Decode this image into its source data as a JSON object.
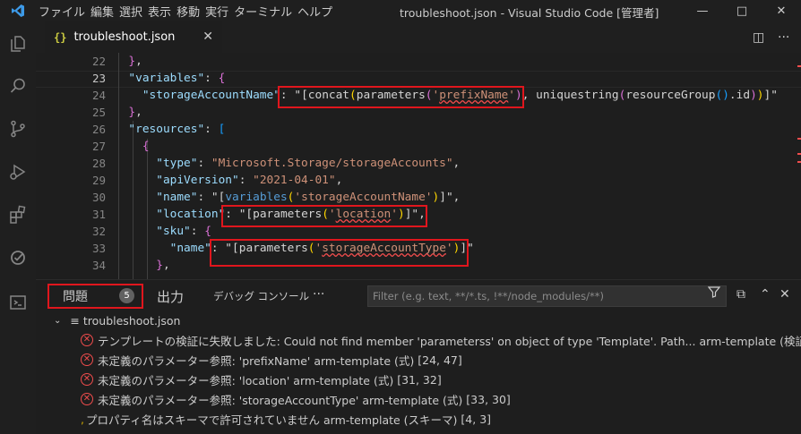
{
  "window": {
    "title": "troubleshoot.json - Visual Studio Code [管理者]",
    "menu": [
      "ファイル",
      "編集",
      "選択",
      "表示",
      "移動",
      "実行",
      "ターミナル",
      "ヘルプ"
    ]
  },
  "tabs": [
    {
      "label": "troubleshoot.json",
      "icon": "json-braces-icon"
    }
  ],
  "editor": {
    "lines": [
      {
        "n": "22",
        "text": "},"
      },
      {
        "n": "23",
        "text": "\"variables\": {"
      },
      {
        "n": "24",
        "text": "\"storageAccountName\": \"[concat(parameters('prefixName'), uniquestring(resourceGroup().id))]\""
      },
      {
        "n": "25",
        "text": "},"
      },
      {
        "n": "26",
        "text": "\"resources\": ["
      },
      {
        "n": "27",
        "text": "{"
      },
      {
        "n": "28",
        "text": "\"type\": \"Microsoft.Storage/storageAccounts\","
      },
      {
        "n": "29",
        "text": "\"apiVersion\": \"2021-04-01\","
      },
      {
        "n": "30",
        "text": "\"name\": \"[variables('storageAccountName')]\","
      },
      {
        "n": "31",
        "text": "\"location\": \"[parameters('location')]\","
      },
      {
        "n": "32",
        "text": "\"sku\": {"
      },
      {
        "n": "33",
        "text": "\"name\": \"[parameters('storageAccountType')]\""
      },
      {
        "n": "34",
        "text": "},"
      }
    ]
  },
  "panel": {
    "tabs": {
      "problems": "問題",
      "problems_count": "5",
      "output": "出力",
      "debug_console": "デバッグ コンソール",
      "more": "···"
    },
    "filter_placeholder": "Filter (e.g. text, **/*.ts, !**/node_modules/**)",
    "file_node": "troubleshoot.json",
    "problems": [
      {
        "severity": "error",
        "message": "テンプレートの検証に失敗しました: Could not find member 'parameterss' on object of type 'Template'. Path...",
        "source": "arm-template (検証)",
        "location": "["
      },
      {
        "severity": "error",
        "message": "未定義のパラメーター参照: 'prefixName'",
        "source": "arm-template (式)",
        "location": "[24, 47]"
      },
      {
        "severity": "error",
        "message": "未定義のパラメーター参照: 'location'",
        "source": "arm-template (式)",
        "location": "[31, 32]"
      },
      {
        "severity": "error",
        "message": "未定義のパラメーター参照: 'storageAccountType'",
        "source": "arm-template (式)",
        "location": "[33, 30]"
      },
      {
        "severity": "warning",
        "message": "プロパティ名はスキーマで許可されていません",
        "source": "arm-template (スキーマ)",
        "location": "[4, 3]"
      }
    ]
  },
  "colors": {
    "highlight_box": "#e0161d",
    "error": "#f14c4c",
    "key": "#9cdcfe",
    "string": "#ce9178",
    "function": "#569cd6"
  }
}
